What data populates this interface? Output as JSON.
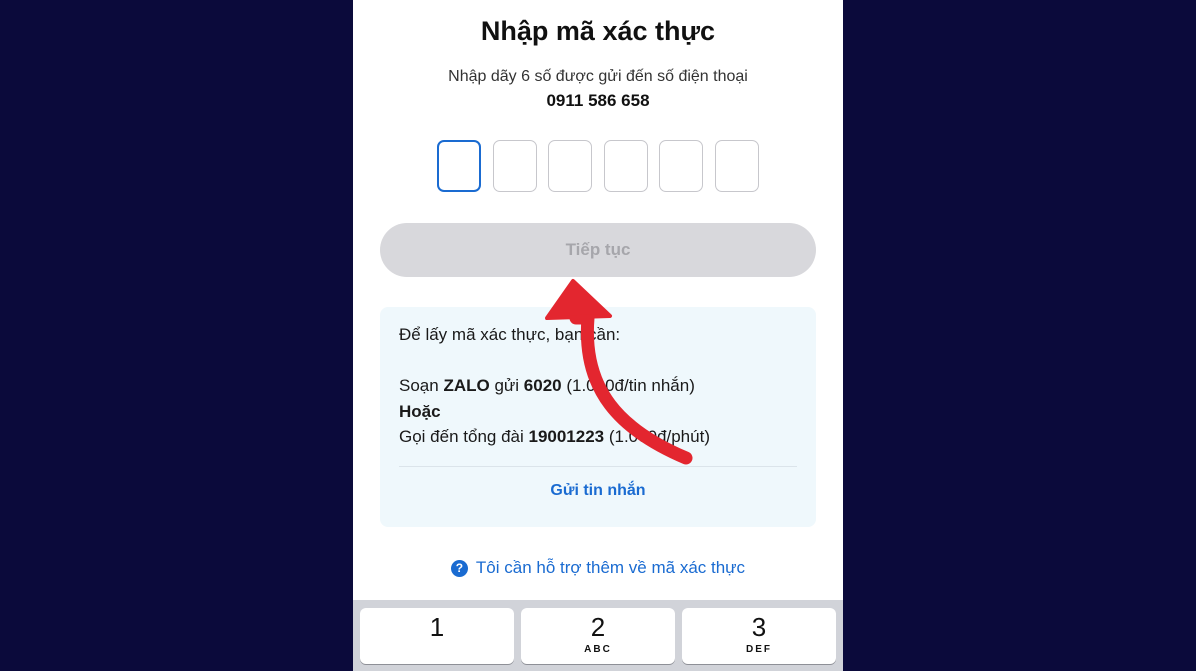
{
  "screen": {
    "title": "Nhập mã xác thực",
    "subtitle": "Nhập dãy 6 số được gửi đến số điện thoại",
    "phone_number": "0911 586 658"
  },
  "otp": {
    "length": 6,
    "active_index": 0,
    "values": [
      "",
      "",
      "",
      "",
      "",
      ""
    ]
  },
  "continue_button": {
    "label": "Tiếp tục",
    "enabled": false
  },
  "info": {
    "intro": "Để lấy mã xác thực, bạn cần:",
    "sms_prefix": "Soạn ",
    "sms_keyword": "ZALO",
    "sms_mid": " gửi ",
    "sms_number": "6020",
    "sms_price": " (1.000đ/tin nhắn)",
    "or": "Hoặc",
    "call_prefix": "Gọi đến tổng đài ",
    "call_number": "19001223",
    "call_price": " (1.000đ/phút)",
    "send_sms_label": "Gửi tin nhắn"
  },
  "help": {
    "icon": "question-circle-icon",
    "label": "Tôi cần hỗ trợ thêm về mã xác thực"
  },
  "keyboard": {
    "keys": [
      {
        "digit": "1",
        "letters": ""
      },
      {
        "digit": "2",
        "letters": "ABC"
      },
      {
        "digit": "3",
        "letters": "DEF"
      }
    ]
  },
  "colors": {
    "background": "#0b0a3b",
    "accent": "#1a6bd1",
    "arrow": "#e3262f",
    "info_bg": "#eff8fc"
  }
}
